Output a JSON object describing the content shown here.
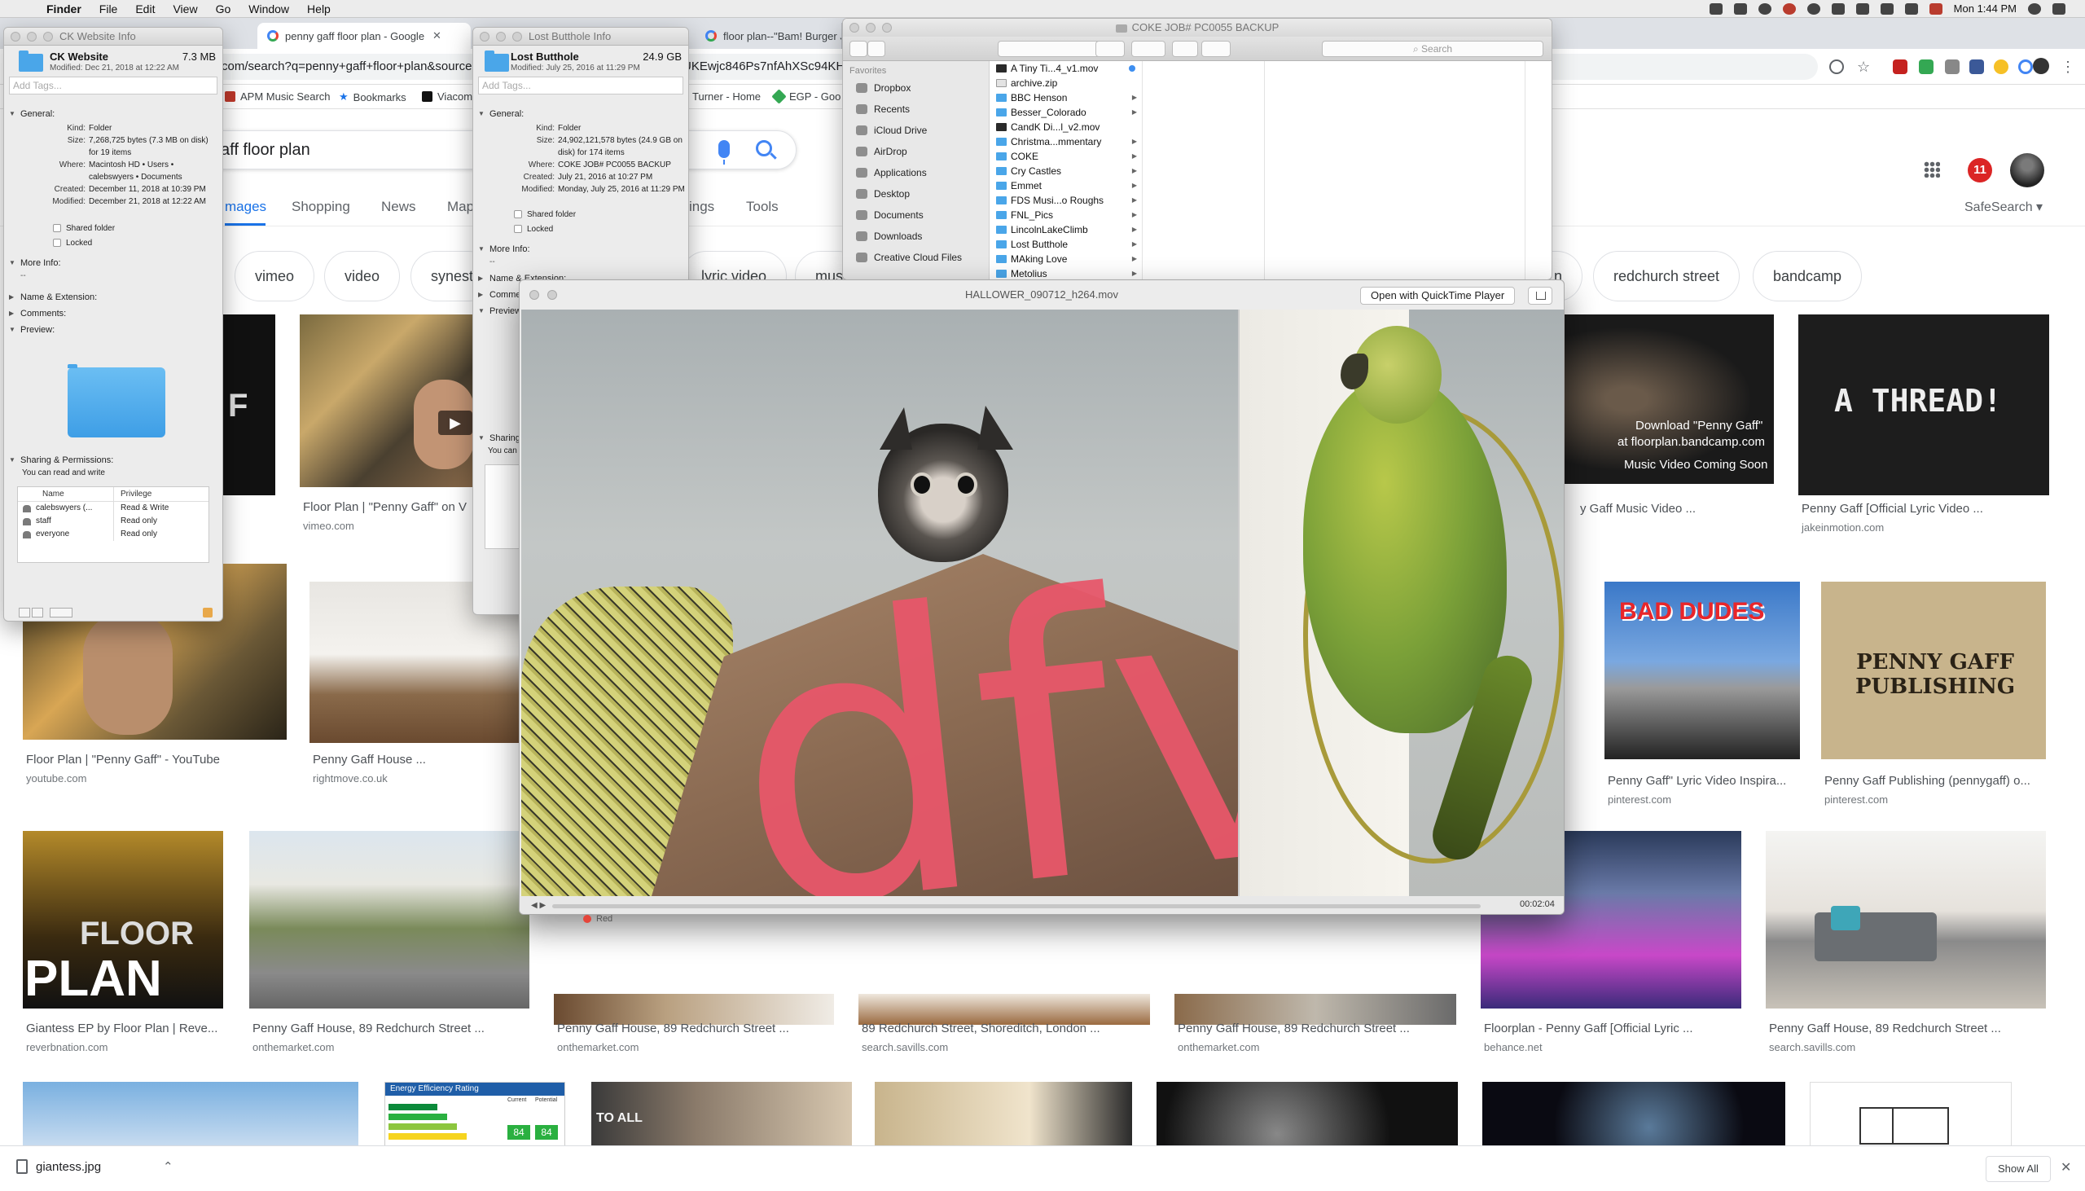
{
  "menubar": {
    "app": "Finder",
    "items": [
      "File",
      "Edit",
      "View",
      "Go",
      "Window",
      "Help"
    ],
    "clock": "Mon 1:44 PM"
  },
  "chrome": {
    "tabs": [
      {
        "label": "penny gaff floor plan - Google"
      },
      {
        "label": "floor plan--\"Bam! Burger Jam\""
      }
    ],
    "url": "google.com/search?q=penny+gaff+floor+plan&source=lnms&tbm=isch&sa=X&ved=0ahUKEwjc846Ps7nfAhXSc94KHXg9ASAQ_AUIDigB",
    "url_visible": "com/search?q=penny+gaff+floor+plan&source=",
    "url_visible_2": "UKEwjc846Ps7nfAhXSc94KH",
    "bookmarks": [
      "APM Music Search",
      "Bookmarks",
      "Viacom",
      "Turner - Home",
      "EGP - Goo"
    ]
  },
  "google": {
    "query": "aff floor plan",
    "nav": [
      "mages",
      "Shopping",
      "News",
      "Map",
      "ings",
      "Tools"
    ],
    "safesearch": "SafeSearch ▾",
    "notifications": "11",
    "chips": [
      "vimeo",
      "video",
      "synest",
      "lyric video",
      "mus",
      "n",
      "redchurch street",
      "bandcamp"
    ],
    "results": [
      {
        "title": "Floor Plan | \"Penny Gaff\" on V",
        "source": "vimeo.com"
      },
      {
        "title": "y Gaff Music Video ...",
        "source": ""
      },
      {
        "title": "Penny Gaff [Official Lyric Video ...",
        "source": "jakeinmotion.com"
      },
      {
        "title": "Floor Plan | \"Penny Gaff\" - YouTube",
        "source": "youtube.com"
      },
      {
        "title": "Penny Gaff House ...",
        "source": "rightmove.co.uk"
      },
      {
        "title": "Penny Gaff\" Lyric Video Inspira...",
        "source": "pinterest.com"
      },
      {
        "title": "Penny Gaff Publishing (pennygaff) o...",
        "source": "pinterest.com"
      },
      {
        "title": "Giantess EP by Floor Plan | Reve...",
        "source": "reverbnation.com"
      },
      {
        "title": "Penny Gaff House, 89 Redchurch Street ...",
        "source": "onthemarket.com"
      },
      {
        "title": "Penny Gaff House, 89 Redchurch Street ...",
        "source": "onthemarket.com"
      },
      {
        "title": "89 Redchurch Street, Shoreditch, London ...",
        "source": "search.savills.com"
      },
      {
        "title": "Penny Gaff House, 89 Redchurch Street ...",
        "source": "onthemarket.com"
      },
      {
        "title": "Floorplan - Penny Gaff [Official Lyric ...",
        "source": "behance.net"
      },
      {
        "title": "Penny Gaff House, 89 Redchurch Street ...",
        "source": "search.savills.com"
      }
    ],
    "thumb_text": {
      "download_1": "Download \"Penny Gaff\"",
      "download_2": "at floorplan.bandcamp.com",
      "download_3": "Music Video Coming Soon",
      "thread": "A THREAD!",
      "bad_dudes": "BAD DUDES",
      "publishing": "PENNY GAFF PUBLISHING",
      "floor": "FLOOR",
      "plan": "PLAN",
      "energy": "Energy Efficiency Rating",
      "energy_current": "Current",
      "energy_potential": "Potential",
      "energy_a": "84",
      "energy_b": "84",
      "to_all": "TO ALL"
    }
  },
  "download_bar": {
    "file": "giantess.jpg",
    "show_all": "Show All"
  },
  "info_ck": {
    "title": "CK Website Info",
    "name": "CK Website",
    "size": "7.3 MB",
    "modified": "Modified: Dec 21, 2018 at 12:22 AM",
    "tags_placeholder": "Add Tags...",
    "general": "General:",
    "rows": [
      {
        "k": "Kind:",
        "v": "Folder"
      },
      {
        "k": "Size:",
        "v": "7,268,725 bytes (7.3 MB on disk)"
      },
      {
        "k": "",
        "v": "for 19 items"
      },
      {
        "k": "Where:",
        "v": "Macintosh HD • Users •"
      },
      {
        "k": "",
        "v": "calebswyers • Documents"
      },
      {
        "k": "Created:",
        "v": "December 11, 2018 at 10:39 PM"
      },
      {
        "k": "Modified:",
        "v": "December 21, 2018 at 12:22 AM"
      }
    ],
    "shared": "Shared folder",
    "locked": "Locked",
    "more_info": "More Info:",
    "more_info_val": "--",
    "name_ext": "Name & Extension:",
    "comments": "Comments:",
    "preview": "Preview:",
    "sharing": "Sharing & Permissions:",
    "sharing_note": "You can read and write",
    "perm_head": [
      "Name",
      "Privilege"
    ],
    "perms": [
      {
        "n": "calebswyers (...",
        "p": "Read & Write"
      },
      {
        "n": "staff",
        "p": "Read only"
      },
      {
        "n": "everyone",
        "p": "Read only"
      }
    ]
  },
  "info_lb": {
    "title": "Lost Butthole Info",
    "name": "Lost Butthole",
    "size": "24.9 GB",
    "modified": "Modified: July 25, 2016 at 11:29 PM",
    "tags_placeholder": "Add Tags...",
    "general": "General:",
    "rows": [
      {
        "k": "Kind:",
        "v": "Folder"
      },
      {
        "k": "Size:",
        "v": "24,902,121,578 bytes (24.9 GB on"
      },
      {
        "k": "",
        "v": "disk) for 174 items"
      },
      {
        "k": "Where:",
        "v": "COKE JOB# PC0055 BACKUP"
      },
      {
        "k": "Created:",
        "v": "July 21, 2016 at 10:27 PM"
      },
      {
        "k": "Modified:",
        "v": "Monday, July 25, 2016 at 11:29 PM"
      }
    ],
    "shared": "Shared folder",
    "locked": "Locked",
    "more_info": "More Info:",
    "more_info_val": "--",
    "name_ext": "Name & Extension:",
    "comments": "Comments:",
    "preview": "Preview:",
    "sharing": "Sharing & Permissions:",
    "sharing_note": "You can read and write"
  },
  "finder": {
    "title": "COKE JOB# PC0055 BACKUP",
    "search_placeholder": "Search",
    "favorites_header": "Favorites",
    "sidebar": [
      "Dropbox",
      "Recents",
      "iCloud Drive",
      "AirDrop",
      "Applications",
      "Desktop",
      "Documents",
      "Downloads",
      "Creative Cloud Files"
    ],
    "items": [
      {
        "name": "A Tiny Ti...4_v1.mov",
        "kind": "file",
        "dot": true
      },
      {
        "name": "archive.zip",
        "kind": "zip"
      },
      {
        "name": "BBC Henson",
        "kind": "folder"
      },
      {
        "name": "Besser_Colorado",
        "kind": "folder"
      },
      {
        "name": "CandK Di...l_v2.mov",
        "kind": "file"
      },
      {
        "name": "Christma...mmentary",
        "kind": "folder"
      },
      {
        "name": "COKE",
        "kind": "folder"
      },
      {
        "name": "Cry Castles",
        "kind": "folder"
      },
      {
        "name": "Emmet",
        "kind": "folder"
      },
      {
        "name": "FDS Musi...o Roughs",
        "kind": "folder"
      },
      {
        "name": "FNL_Pics",
        "kind": "folder"
      },
      {
        "name": "LincolnLakeClimb",
        "kind": "folder"
      },
      {
        "name": "Lost Butthole",
        "kind": "folder"
      },
      {
        "name": "MAking Love",
        "kind": "folder"
      },
      {
        "name": "Metolius",
        "kind": "folder"
      }
    ]
  },
  "quicktime": {
    "title": "HALLOWER_090712_h264.mov",
    "open_button": "Open with QuickTime Player",
    "time": "00:02:04",
    "overlay_text": "dfv",
    "tag_label": "Red"
  },
  "colors": {
    "accent": "#1a73e8",
    "badge": "#db2525",
    "folder": "#4aa6e9"
  }
}
